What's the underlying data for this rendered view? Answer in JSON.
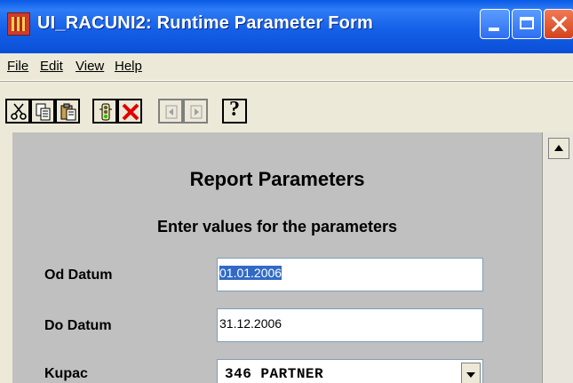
{
  "window": {
    "title": "UI_RACUNI2: Runtime Parameter Form",
    "icon": "application-icon",
    "controls": [
      "minimize",
      "maximize",
      "close"
    ]
  },
  "menu": {
    "items": [
      {
        "label": "File",
        "underline": "F"
      },
      {
        "label": "Edit",
        "underline": "E"
      },
      {
        "label": "View",
        "underline": "V"
      },
      {
        "label": "Help",
        "underline": "H"
      }
    ]
  },
  "toolbar": {
    "buttons": [
      "cut-icon",
      "copy-icon",
      "paste-icon",
      "run-report-icon",
      "cancel-icon",
      "previous-page-icon",
      "next-page-icon",
      "help-icon"
    ],
    "help_label": "?"
  },
  "form": {
    "heading": "Report Parameters",
    "subheading": "Enter values for the parameters",
    "fields": [
      {
        "label": "Od Datum",
        "value": "01.01.2006",
        "selected": true
      },
      {
        "label": "Do Datum",
        "value": "31.12.2006",
        "selected": false
      },
      {
        "label": "Kupac",
        "value": "346 PARTNER",
        "type": "dropdown"
      }
    ]
  },
  "colors": {
    "titlebar": "#0A5BE6",
    "panel": "#C0C0C0",
    "selection": "#316AC5",
    "chrome": "#ECE9D8"
  }
}
